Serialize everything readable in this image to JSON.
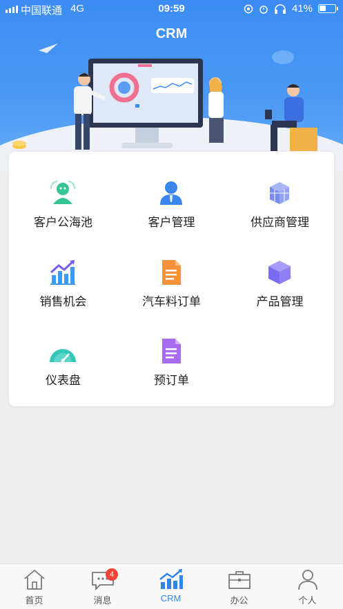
{
  "status_bar": {
    "carrier": "中国联通",
    "network": "4G",
    "time": "09:59",
    "battery": "41%",
    "battery_level": 0.41
  },
  "header": {
    "title": "CRM"
  },
  "menu": [
    {
      "label": "客户公海池",
      "icon": "customer-pool-icon",
      "color": "#2fc08e"
    },
    {
      "label": "客户管理",
      "icon": "customer-manage-icon",
      "color": "#3a86ee"
    },
    {
      "label": "供应商管理",
      "icon": "supplier-icon",
      "color": "#7b8cf0"
    },
    {
      "label": "销售机会",
      "icon": "sales-chart-icon",
      "color": "#3c9af2"
    },
    {
      "label": "汽车料订单",
      "icon": "document-orange-icon",
      "color": "#f7803c"
    },
    {
      "label": "产品管理",
      "icon": "cube-icon",
      "color": "#7a6cf1"
    },
    {
      "label": "仪表盘",
      "icon": "dashboard-gauge-icon",
      "color": "#2fc0b8"
    },
    {
      "label": "预订单",
      "icon": "document-purple-icon",
      "color": "#a86cf0"
    }
  ],
  "tabbar": {
    "tabs": [
      {
        "label": "首页",
        "icon": "home-icon"
      },
      {
        "label": "消息",
        "icon": "message-icon",
        "badge": "4"
      },
      {
        "label": "CRM",
        "icon": "crm-chart-icon",
        "active": true
      },
      {
        "label": "办公",
        "icon": "briefcase-icon"
      },
      {
        "label": "个人",
        "icon": "person-icon"
      }
    ]
  },
  "colors": {
    "accent": "#2f86e8",
    "badge": "#f0463a",
    "banner": "#3b8cf3"
  }
}
